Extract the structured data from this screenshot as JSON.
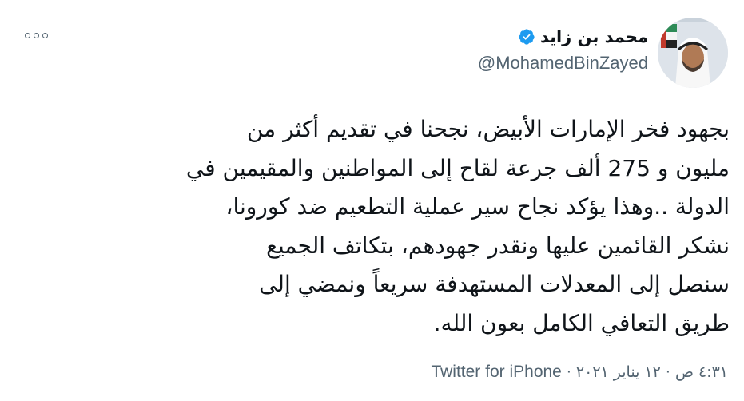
{
  "author": {
    "display_name": "محمد بن زايد",
    "handle": "@MohamedBinZayed",
    "verified": true
  },
  "tweet": {
    "lines": [
      "بجهود فخر الإمارات الأبيض، نجحنا في تقديم أكثر من",
      "مليون و 275 ألف جرعة لقاح إلى المواطنين والمقيمين في",
      "الدولة ..وهذا يؤكد نجاح سير عملية التطعيم ضد كورونا،",
      "نشكر القائمين عليها ونقدر جهودهم، بتكاتف الجميع",
      "سنصل إلى المعدلات المستهدفة سريعاً ونمضي إلى",
      "طريق التعافي الكامل بعون الله."
    ],
    "timestamp": "٤:٣١ ص · ١٢ يناير ٢٠٢١",
    "separator": "·",
    "source": "Twitter for iPhone"
  },
  "colors": {
    "text": "#0f1419",
    "secondary": "#536471",
    "verified_badge": "#1d9bf0"
  },
  "icons": {
    "more": "more-dots-icon",
    "verified": "verified-badge-icon"
  }
}
